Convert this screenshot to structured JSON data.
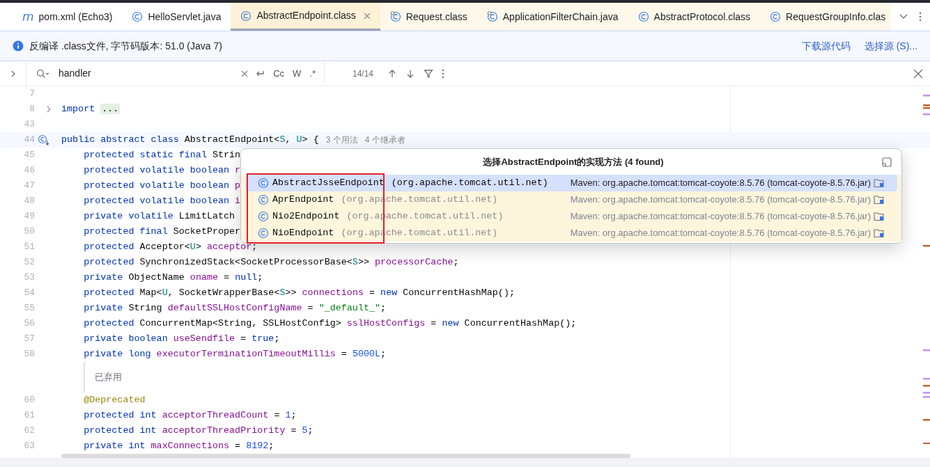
{
  "tabs": [
    {
      "label": "pom.xml (Echo3)",
      "kind": "maven",
      "icon_text": "m",
      "library": false,
      "selected": false
    },
    {
      "label": "HelloServlet.java",
      "kind": "class",
      "library": false,
      "selected": false
    },
    {
      "label": "AbstractEndpoint.class",
      "kind": "class",
      "library": false,
      "selected": true
    },
    {
      "label": "Request.class",
      "kind": "class-pinned",
      "library": true,
      "selected": false
    },
    {
      "label": "ApplicationFilterChain.java",
      "kind": "class-pinned",
      "library": true,
      "selected": false
    },
    {
      "label": "AbstractProtocol.class",
      "kind": "class",
      "library": true,
      "selected": false
    },
    {
      "label": "RequestGroupInfo.clas",
      "kind": "class",
      "library": true,
      "selected": false
    }
  ],
  "info_bar": {
    "message": "反编译 .class文件, 字节码版本: 51.0 (Java 7)",
    "links": [
      "下载源代码",
      "选择源 (S)..."
    ]
  },
  "find_bar": {
    "value": "handler",
    "options": [
      "Cc",
      "W",
      ".*"
    ],
    "count": "14/14"
  },
  "editor": {
    "lines": [
      {
        "kind": "code",
        "number": "7"
      },
      {
        "kind": "fold",
        "number": "8",
        "tokens": [
          {
            "kind": "kw",
            "text": "import "
          },
          {
            "kind": "folded",
            "text": "..."
          }
        ]
      },
      {
        "kind": "code",
        "number": "43"
      },
      {
        "kind": "class",
        "number": "44",
        "tokens": [
          {
            "kind": "kw",
            "text": "public abstract class "
          },
          {
            "kind": "plain",
            "text": "AbstractEndpoint<"
          },
          {
            "kind": "tparam",
            "text": "S"
          },
          {
            "kind": "plain",
            "text": ", "
          },
          {
            "kind": "tparam",
            "text": "U"
          },
          {
            "kind": "plain",
            "text": "> {"
          }
        ],
        "hints": [
          "3 个用法",
          "4 个继承者"
        ]
      },
      {
        "kind": "code",
        "number": "45",
        "tokens": [
          {
            "kind": "kw",
            "text": "    protected static final "
          },
          {
            "kind": "plain",
            "text": "Strin"
          }
        ]
      },
      {
        "kind": "code",
        "number": "46",
        "tokens": [
          {
            "kind": "kw",
            "text": "    protected volatile boolean "
          },
          {
            "kind": "field",
            "text": "r"
          }
        ]
      },
      {
        "kind": "code",
        "number": "47",
        "tokens": [
          {
            "kind": "kw",
            "text": "    protected volatile boolean "
          },
          {
            "kind": "field",
            "text": "p"
          }
        ]
      },
      {
        "kind": "code",
        "number": "48",
        "tokens": [
          {
            "kind": "kw",
            "text": "    protected volatile boolean "
          },
          {
            "kind": "field",
            "text": "i"
          }
        ]
      },
      {
        "kind": "code",
        "number": "49",
        "tokens": [
          {
            "kind": "kw",
            "text": "    private volatile "
          },
          {
            "kind": "plain",
            "text": "LimitLatch"
          }
        ]
      },
      {
        "kind": "code",
        "number": "50",
        "tokens": [
          {
            "kind": "kw",
            "text": "    protected final "
          },
          {
            "kind": "plain",
            "text": "SocketProper"
          }
        ]
      },
      {
        "kind": "code",
        "number": "51",
        "tokens": [
          {
            "kind": "kw",
            "text": "    protected "
          },
          {
            "kind": "plain",
            "text": "Acceptor<"
          },
          {
            "kind": "tparam",
            "text": "U"
          },
          {
            "kind": "plain",
            "text": "> "
          },
          {
            "kind": "field",
            "text": "acceptor"
          },
          {
            "kind": "plain",
            "text": ";"
          }
        ]
      },
      {
        "kind": "code",
        "number": "52",
        "tokens": [
          {
            "kind": "kw",
            "text": "    protected "
          },
          {
            "kind": "plain",
            "text": "SynchronizedStack<SocketProcessorBase<"
          },
          {
            "kind": "tparam",
            "text": "S"
          },
          {
            "kind": "plain",
            "text": ">> "
          },
          {
            "kind": "field",
            "text": "processorCache"
          },
          {
            "kind": "plain",
            "text": ";"
          }
        ]
      },
      {
        "kind": "code",
        "number": "53",
        "tokens": [
          {
            "kind": "kw",
            "text": "    private "
          },
          {
            "kind": "plain",
            "text": "ObjectName "
          },
          {
            "kind": "field",
            "text": "oname"
          },
          {
            "kind": "plain",
            "text": " = "
          },
          {
            "kind": "kw",
            "text": "null"
          },
          {
            "kind": "plain",
            "text": ";"
          }
        ]
      },
      {
        "kind": "code",
        "number": "54",
        "tokens": [
          {
            "kind": "kw",
            "text": "    protected "
          },
          {
            "kind": "plain",
            "text": "Map<"
          },
          {
            "kind": "tparam",
            "text": "U"
          },
          {
            "kind": "plain",
            "text": ", SocketWrapperBase<"
          },
          {
            "kind": "tparam",
            "text": "S"
          },
          {
            "kind": "plain",
            "text": ">> "
          },
          {
            "kind": "field",
            "text": "connections"
          },
          {
            "kind": "plain",
            "text": " = "
          },
          {
            "kind": "kw",
            "text": "new "
          },
          {
            "kind": "plain",
            "text": "ConcurrentHashMap();"
          }
        ]
      },
      {
        "kind": "code",
        "number": "55",
        "tokens": [
          {
            "kind": "kw",
            "text": "    private "
          },
          {
            "kind": "plain",
            "text": "String "
          },
          {
            "kind": "field",
            "text": "defaultSSLHostConfigName"
          },
          {
            "kind": "plain",
            "text": " = "
          },
          {
            "kind": "str",
            "text": "\"_default_\""
          },
          {
            "kind": "plain",
            "text": ";"
          }
        ]
      },
      {
        "kind": "code",
        "number": "56",
        "tokens": [
          {
            "kind": "kw",
            "text": "    protected "
          },
          {
            "kind": "plain",
            "text": "ConcurrentMap<String, SSLHostConfig> "
          },
          {
            "kind": "field",
            "text": "sslHostConfigs"
          },
          {
            "kind": "plain",
            "text": " = "
          },
          {
            "kind": "kw",
            "text": "new "
          },
          {
            "kind": "plain",
            "text": "ConcurrentHashMap();"
          }
        ]
      },
      {
        "kind": "code",
        "number": "57",
        "tokens": [
          {
            "kind": "kw",
            "text": "    private boolean "
          },
          {
            "kind": "field",
            "text": "useSendfile"
          },
          {
            "kind": "plain",
            "text": " = "
          },
          {
            "kind": "kw",
            "text": "true"
          },
          {
            "kind": "plain",
            "text": ";"
          }
        ]
      },
      {
        "kind": "code",
        "number": "58",
        "tokens": [
          {
            "kind": "kw",
            "text": "    private long "
          },
          {
            "kind": "field",
            "text": "executorTerminationTimeoutMillis"
          },
          {
            "kind": "plain",
            "text": " = "
          },
          {
            "kind": "num",
            "text": "5000L"
          },
          {
            "kind": "plain",
            "text": ";"
          }
        ]
      },
      {
        "kind": "doc",
        "text": "已弃用"
      },
      {
        "kind": "code",
        "number": "60",
        "tokens": [
          {
            "kind": "ann",
            "text": "    @Deprecated"
          }
        ]
      },
      {
        "kind": "code",
        "number": "61",
        "tokens": [
          {
            "kind": "kw",
            "text": "    protected int "
          },
          {
            "kind": "field",
            "text": "acceptorThreadCount"
          },
          {
            "kind": "plain",
            "text": " = "
          },
          {
            "kind": "num",
            "text": "1"
          },
          {
            "kind": "plain",
            "text": ";"
          }
        ]
      },
      {
        "kind": "code",
        "number": "62",
        "tokens": [
          {
            "kind": "kw",
            "text": "    protected int "
          },
          {
            "kind": "field",
            "text": "acceptorThreadPriority"
          },
          {
            "kind": "plain",
            "text": " = "
          },
          {
            "kind": "num",
            "text": "5"
          },
          {
            "kind": "plain",
            "text": ";"
          }
        ]
      },
      {
        "kind": "code",
        "number": "63",
        "tokens": [
          {
            "kind": "kw",
            "text": "    private int "
          },
          {
            "kind": "field",
            "text": "maxConnections"
          },
          {
            "kind": "plain",
            "text": " = "
          },
          {
            "kind": "num",
            "text": "8192"
          },
          {
            "kind": "plain",
            "text": ";"
          }
        ]
      }
    ]
  },
  "popup": {
    "title": "选择AbstractEndpoint的实现方法 (4 found)",
    "items": [
      {
        "name": "AbstractJsseEndpoint",
        "package": "(org.apache.tomcat.util.net)",
        "location": "Maven: org.apache.tomcat:tomcat-coyote:8.5.76 (tomcat-coyote-8.5.76.jar)",
        "selected": true
      },
      {
        "name": "AprEndpoint",
        "package": "(org.apache.tomcat.util.net)",
        "location": "Maven: org.apache.tomcat:tomcat-coyote:8.5.76 (tomcat-coyote-8.5.76.jar)",
        "selected": false
      },
      {
        "name": "Nio2Endpoint",
        "package": "(org.apache.tomcat.util.net)",
        "location": "Maven: org.apache.tomcat:tomcat-coyote:8.5.76 (tomcat-coyote-8.5.76.jar)",
        "selected": false
      },
      {
        "name": "NioEndpoint",
        "package": "(org.apache.tomcat.util.net)",
        "location": "Maven: org.apache.tomcat:tomcat-coyote:8.5.76 (tomcat-coyote-8.5.76.jar)",
        "selected": false
      }
    ]
  }
}
